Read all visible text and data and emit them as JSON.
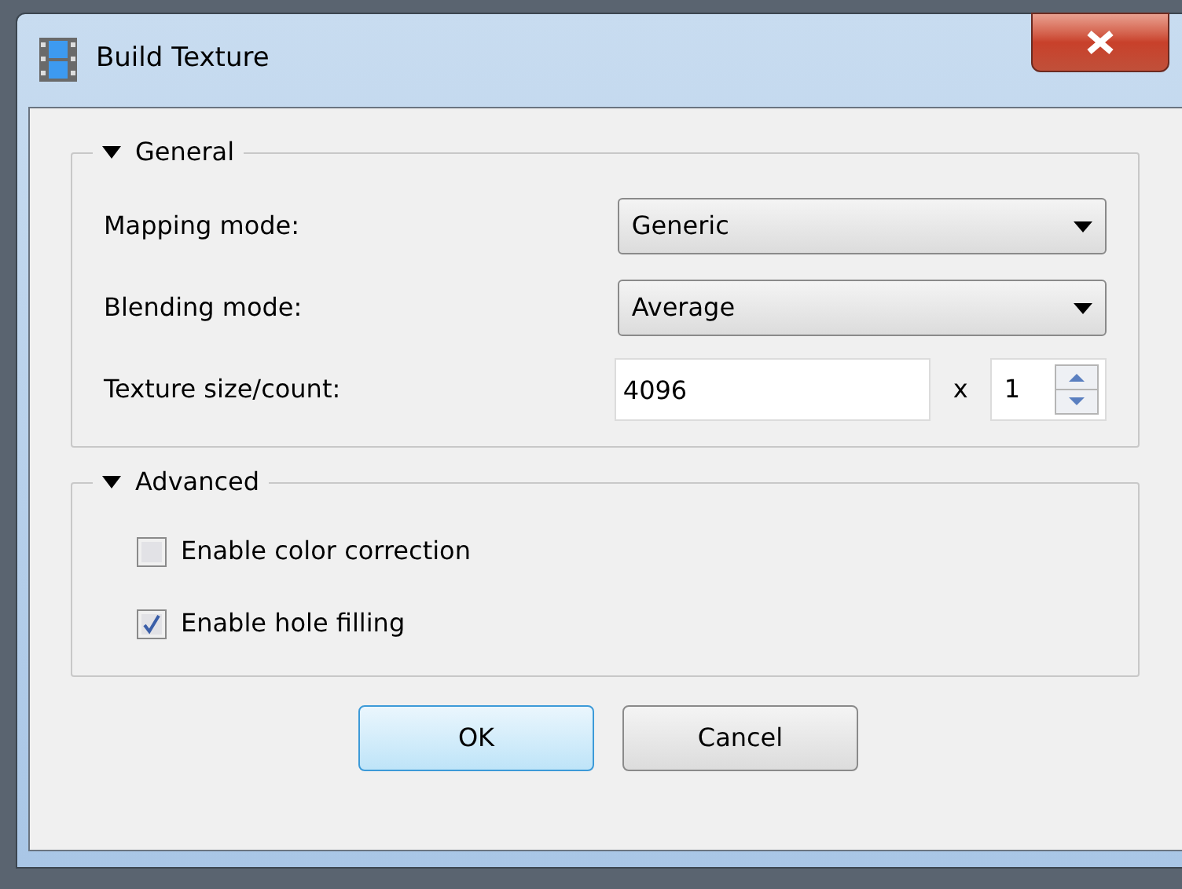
{
  "window": {
    "title": "Build Texture"
  },
  "sections": [
    {
      "title": "General",
      "expanded": true,
      "rows": [
        {
          "kind": "dropdown",
          "label": "Mapping mode:",
          "value": "Generic"
        },
        {
          "kind": "dropdown",
          "label": "Blending mode:",
          "value": "Average"
        },
        {
          "kind": "size",
          "label": "Texture size/count:",
          "value": "4096",
          "separator": "x",
          "count": "1"
        }
      ]
    },
    {
      "title": "Advanced",
      "expanded": true,
      "rows": [
        {
          "kind": "checkbox",
          "label": "Enable color correction",
          "checked": false
        },
        {
          "kind": "checkbox",
          "label": "Enable hole filling",
          "checked": true
        }
      ]
    }
  ],
  "buttons": [
    {
      "label": "OK",
      "default": true
    },
    {
      "label": "Cancel",
      "default": false
    }
  ]
}
